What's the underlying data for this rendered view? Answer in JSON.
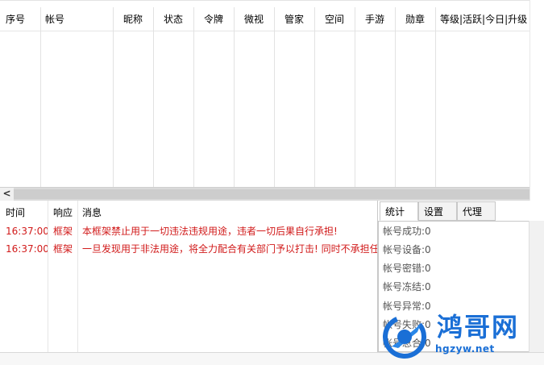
{
  "account_table": {
    "columns": [
      "序号",
      "帐号",
      "昵称",
      "状态",
      "令牌",
      "微视",
      "管家",
      "空间",
      "手游",
      "勋章",
      "等级|活跃|今日|升级"
    ],
    "rows": []
  },
  "log_table": {
    "columns": [
      "时间",
      "响应",
      "消息"
    ],
    "rows": [
      {
        "time": "16:37:00",
        "response": "框架",
        "message": "本框架禁止用于一切违法违规用途，违者一切后果自行承担!"
      },
      {
        "time": "16:37:00",
        "response": "框架",
        "message": "一旦发现用于非法用途，将全力配合有关部门予以打击! 同时不承担任"
      }
    ]
  },
  "tabs": [
    "统计",
    "设置",
    "代理"
  ],
  "active_tab": "统计",
  "stats": [
    {
      "label": "帐号成功:",
      "value": "0"
    },
    {
      "label": "帐号设备:",
      "value": "0"
    },
    {
      "label": "帐号密错:",
      "value": "0"
    },
    {
      "label": "帐号冻结:",
      "value": "0"
    },
    {
      "label": "帐号异常:",
      "value": "0"
    },
    {
      "label": "帐号失败:",
      "value": "0"
    },
    {
      "label": "帐号总合:",
      "value": "0"
    }
  ],
  "scroll_left_glyph": "<",
  "watermark": {
    "title": "鸿哥网",
    "url": "hgzyw.net"
  },
  "colors": {
    "log_text": "#d11a1a",
    "watermark": "#1a6fd6"
  }
}
